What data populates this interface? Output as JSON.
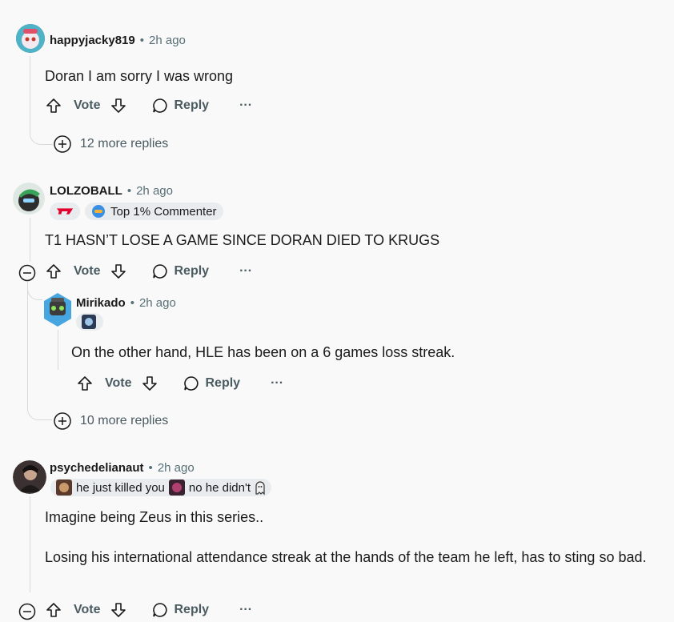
{
  "comments": [
    {
      "username": "happyjacky819",
      "time": "2h ago",
      "body": [
        "Doran I am sorry I was wrong"
      ],
      "actions": {
        "vote": "Vote",
        "reply": "Reply",
        "more": "···"
      },
      "more_replies": "12 more replies"
    },
    {
      "username": "LOLZOBALL",
      "time": "2h ago",
      "flair": "Top 1% Commenter",
      "body": [
        "T1 HASN’T LOSE A GAME SINCE DORAN DIED TO KRUGS"
      ],
      "actions": {
        "vote": "Vote",
        "reply": "Reply",
        "more": "···"
      },
      "reply": {
        "username": "Mirikado",
        "time": "2h ago",
        "body": [
          "On the other hand, HLE has been on a 6 games loss streak."
        ],
        "actions": {
          "vote": "Vote",
          "reply": "Reply",
          "more": "···"
        }
      },
      "more_replies": "10 more replies"
    },
    {
      "username": "psychedelianaut",
      "time": "2h ago",
      "flair_part1": "he just killed you",
      "flair_part2": "no he didn't",
      "body": [
        "Imagine being Zeus in this series..",
        "Losing his international attendance streak at the hands of the team he left, has to sting so bad."
      ],
      "actions": {
        "vote": "Vote",
        "reply": "Reply",
        "more": "···"
      }
    }
  ],
  "colors": {
    "background": "#f9f9f9",
    "thread": "#d6dadc",
    "muted": "#576f76",
    "t1_red": "#e2012d"
  }
}
